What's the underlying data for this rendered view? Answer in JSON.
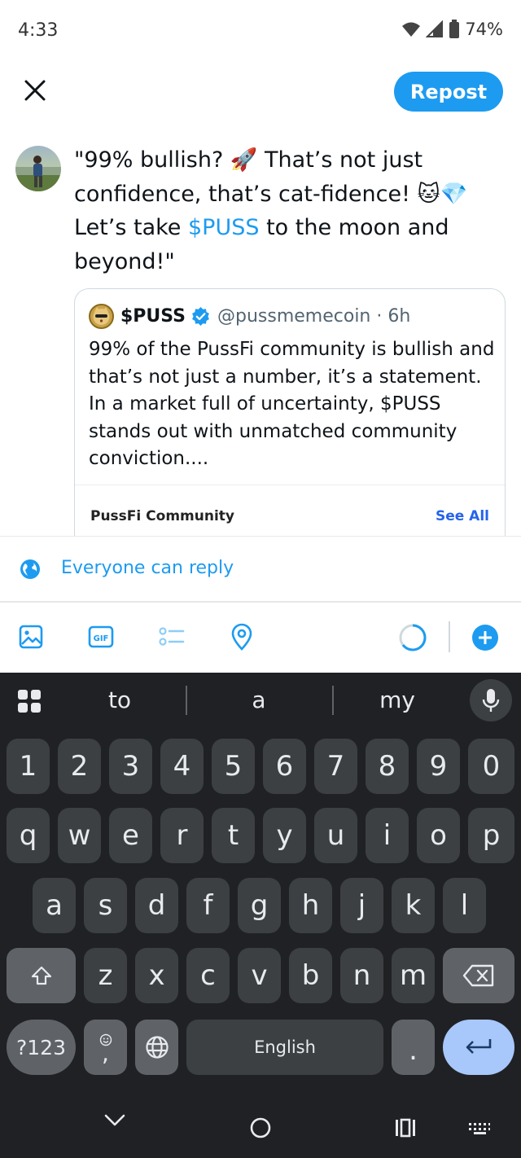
{
  "status": {
    "time": "4:33",
    "battery": "74%"
  },
  "header": {
    "repost_label": "Repost"
  },
  "composer": {
    "line1": "\"99% bullish? 🚀 That’s not just",
    "line2_pre": "confidence, that’s cat-fidence! 🐱💎",
    "line3_pre": "Let’s take ",
    "line3_tag": "$PUSS",
    "line3_post": " to the moon and",
    "line4": "beyond!\""
  },
  "quote": {
    "name": "$PUSS",
    "handle": "@pussmemecoin · 6h",
    "body": [
      "99% of the PussFi community is bullish and",
      "that’s not just a number, it’s a statement.",
      "In a market full of uncertainty, $PUSS",
      "stands out with unmatched community",
      "conviction...."
    ],
    "card_title": "PussFi Community",
    "card_link": "See All"
  },
  "reply": {
    "label": "Everyone can reply"
  },
  "toolbar": {
    "icons": [
      "image-icon",
      "gif-icon",
      "poll-icon",
      "location-icon"
    ],
    "accent": "#1d9bf0"
  },
  "keyboard": {
    "suggestions": [
      "to",
      "a",
      "my"
    ],
    "row_numbers": [
      "1",
      "2",
      "3",
      "4",
      "5",
      "6",
      "7",
      "8",
      "9",
      "0"
    ],
    "row1": [
      "q",
      "w",
      "e",
      "r",
      "t",
      "y",
      "u",
      "i",
      "o",
      "p"
    ],
    "row2": [
      "a",
      "s",
      "d",
      "f",
      "g",
      "h",
      "j",
      "k",
      "l"
    ],
    "row3": [
      "z",
      "x",
      "c",
      "v",
      "b",
      "n",
      "m"
    ],
    "sym_label": "?123",
    "comma": ",",
    "period": ".",
    "space_label": "English"
  }
}
